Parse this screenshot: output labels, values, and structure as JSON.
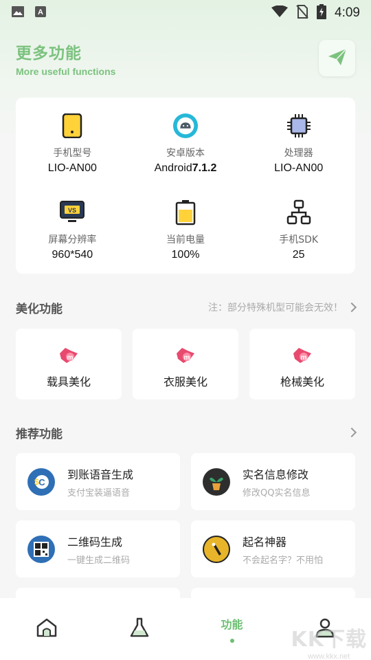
{
  "status_bar": {
    "time": "4:09"
  },
  "header": {
    "title": "更多功能",
    "subtitle": "More useful functions"
  },
  "device_info": [
    {
      "label": "手机型号",
      "value": "LIO-AN00",
      "icon": "phone-icon"
    },
    {
      "label": "安卓版本",
      "value_prefix": "Android",
      "value_bold": "7.1.2",
      "icon": "android-icon"
    },
    {
      "label": "处理器",
      "value": "LIO-AN00",
      "icon": "cpu-icon"
    },
    {
      "label": "屏幕分辨率",
      "value": "960*540",
      "icon": "monitor-icon"
    },
    {
      "label": "当前电量",
      "value": "100%",
      "icon": "battery-icon"
    },
    {
      "label": "手机SDK",
      "value": "25",
      "icon": "network-icon"
    }
  ],
  "beauty": {
    "title": "美化功能",
    "note": "注：部分特殊机型可能会无效！",
    "items": [
      {
        "label": "载具美化"
      },
      {
        "label": "衣服美化"
      },
      {
        "label": "枪械美化"
      }
    ]
  },
  "recommended": {
    "title": "推荐功能",
    "items": [
      {
        "title": "到账语音生成",
        "subtitle": "支付宝装逼语音",
        "icon": "money-icon"
      },
      {
        "title": "实名信息修改",
        "subtitle": "修改QQ实名信息",
        "icon": "plant-icon"
      },
      {
        "title": "二维码生成",
        "subtitle": "一键生成二维码",
        "icon": "qrcode-icon"
      },
      {
        "title": "起名神器",
        "subtitle": "不会起名字？不用怕",
        "icon": "pen-icon"
      }
    ]
  },
  "bottom_nav": {
    "active_label": "功能"
  },
  "watermark": {
    "big": "KK下载",
    "small": "www.kkx.net"
  },
  "colors": {
    "accent": "#7cc27f",
    "card": "#ffffff",
    "bg": "#f5f6f5"
  }
}
